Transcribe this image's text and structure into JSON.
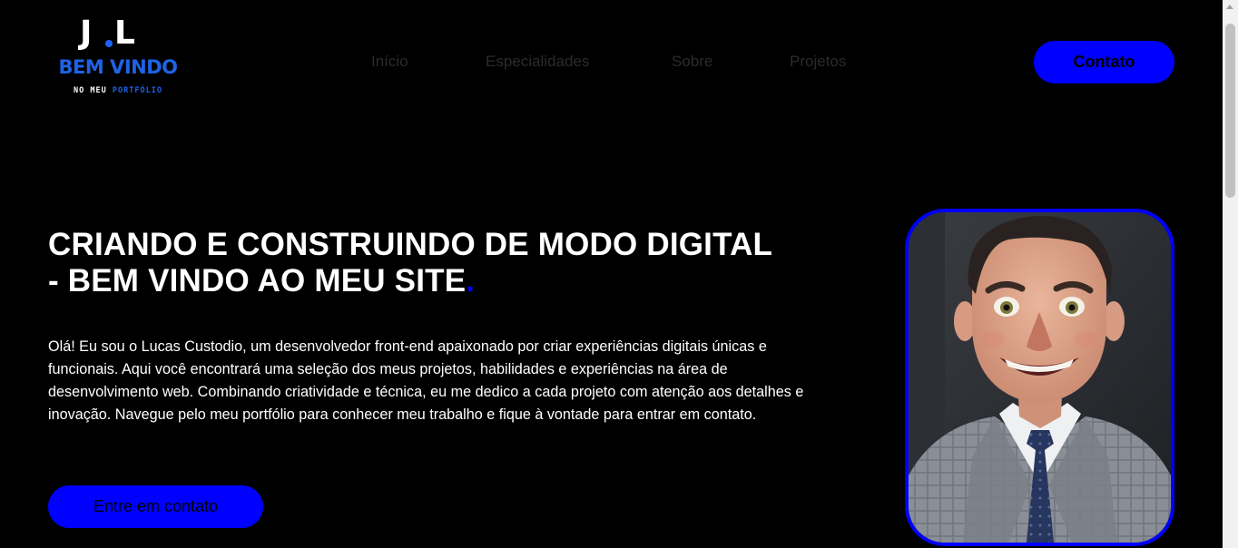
{
  "logo": {
    "mark_left": "J",
    "mark_right": "L",
    "title": "BEM VINDO",
    "subtitle_white": "NO MEU",
    "subtitle_blue": "PORTFÓLIO"
  },
  "nav": {
    "items": [
      "Início",
      "Especialidades",
      "Sobre",
      "Projetos"
    ],
    "contact_label": "Contato"
  },
  "hero": {
    "title_line1": "CRIANDO E CONSTRUINDO DE MODO DIGITAL",
    "title_line2": "- BEM VINDO AO MEU SITE",
    "title_dot": ".",
    "paragraph": "Olá! Eu sou o Lucas Custodio, um desenvolvedor front-end apaixonado por criar experiências digitais únicas e funcionais. Aqui você encontrará uma seleção dos meus projetos, habilidades e experiências na área de desenvolvimento web. Combinando criatividade e técnica, eu me dedico a cada projeto com atenção aos detalhes e inovação. Navegue pelo meu portfólio para conhecer meu trabalho e fique à vontade para entrar em contato.",
    "cta_label": "Entre em contato"
  },
  "colors": {
    "background": "#000000",
    "accent": "#0000ff",
    "logo_blue": "#1e63e6",
    "nav_text": "#2b2b2b",
    "text": "#ffffff"
  },
  "icons": {
    "portrait": "cartoon-avatar-portrait"
  }
}
